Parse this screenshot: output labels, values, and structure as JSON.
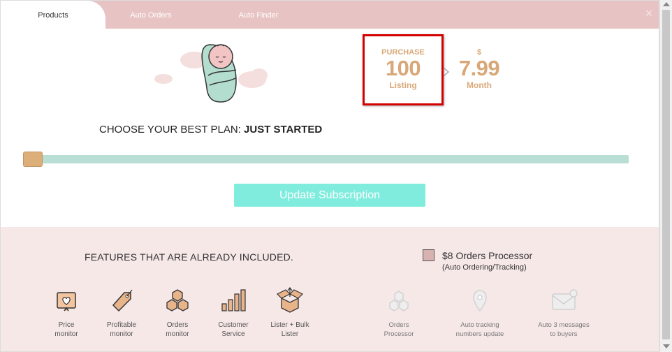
{
  "tabs": [
    {
      "label": "Products",
      "active": true
    },
    {
      "label": "Auto Orders",
      "active": false
    },
    {
      "label": "Auto Finder",
      "active": false
    }
  ],
  "close_label": "×",
  "purchase": {
    "caption": "PURCHASE",
    "value": "100",
    "unit": "Listing"
  },
  "price": {
    "currency": "$",
    "value": "7.99",
    "unit": "Month"
  },
  "plan": {
    "prefix": "CHOOSE YOUR BEST PLAN:",
    "name": "JUST STARTED"
  },
  "slider": {
    "level": 0
  },
  "update_button": "Update Subscription",
  "features": {
    "title": "FEATURES THAT ARE ALREADY INCLUDED.",
    "included": [
      {
        "icon": "price-monitor-icon",
        "line1": "Price",
        "line2": "monitor"
      },
      {
        "icon": "price-tag-icon",
        "line1": "Profitable",
        "line2": "monitor"
      },
      {
        "icon": "boxes-icon",
        "line1": "Orders",
        "line2": "monitor"
      },
      {
        "icon": "bar-chart-icon",
        "line1": "Customer",
        "line2": "Service"
      },
      {
        "icon": "open-box-icon",
        "line1": "Lister + Bulk",
        "line2": "Lister"
      }
    ],
    "processor": {
      "title": "$8 Orders Processor",
      "subtitle": "(Auto Ordering/Tracking)",
      "checked": false
    },
    "addons": [
      {
        "icon": "boxes-icon",
        "line1": "Orders",
        "line2": "Processor"
      },
      {
        "icon": "location-pin-icon",
        "line1": "Auto tracking",
        "line2": "numbers update"
      },
      {
        "icon": "mail-icon",
        "line1": "Auto 3 messages",
        "line2": "to buyers"
      }
    ]
  },
  "colors": {
    "tab_bar": "#e8c3c3",
    "accent_gold": "#d9a878",
    "slider_track": "#b9dfd4",
    "button": "#7fecdd",
    "highlight_border": "#d40000",
    "features_bg": "#f7e8e8"
  }
}
